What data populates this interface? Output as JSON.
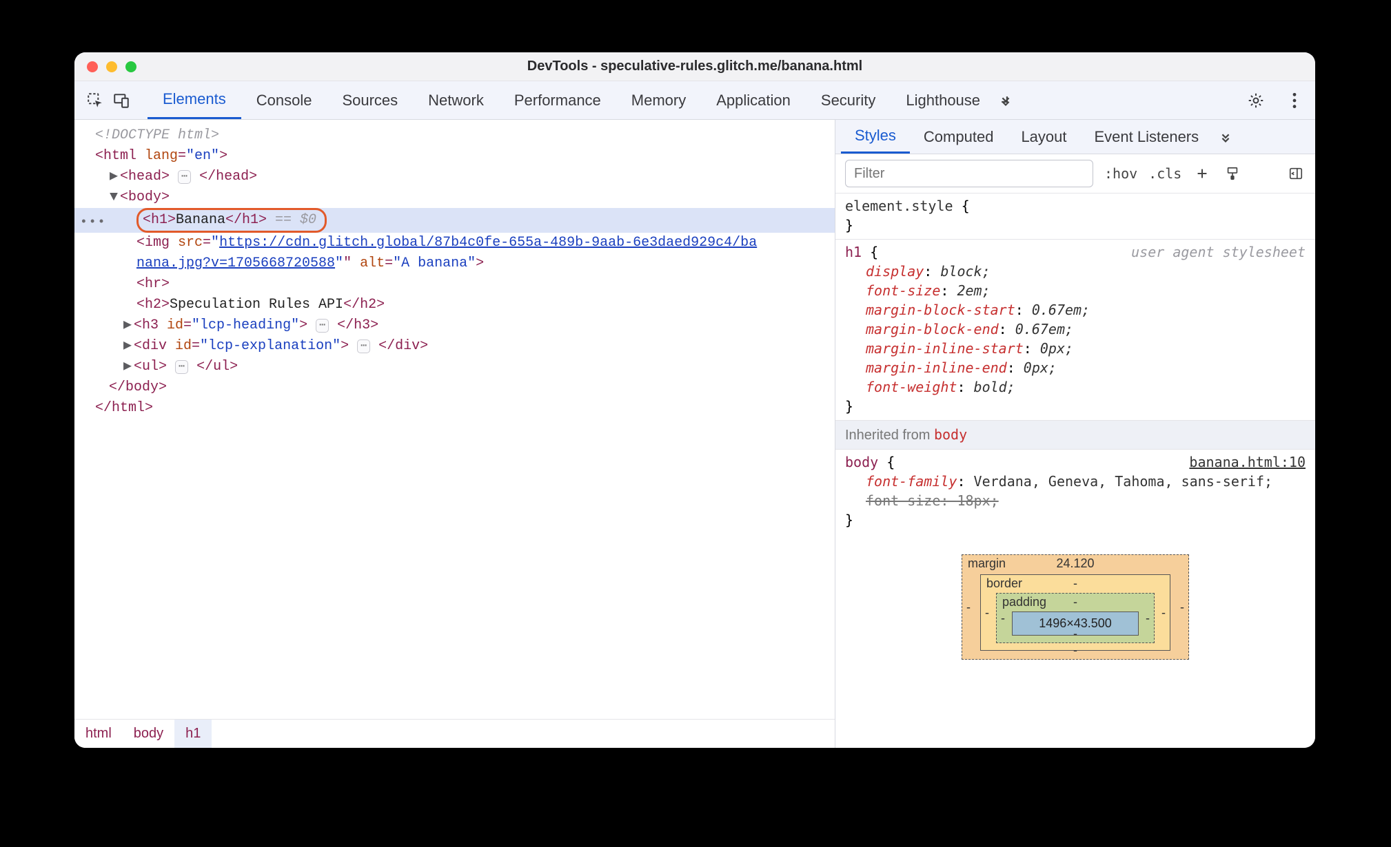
{
  "window": {
    "title": "DevTools - speculative-rules.glitch.me/banana.html"
  },
  "mainTabs": {
    "items": [
      "Elements",
      "Console",
      "Sources",
      "Network",
      "Performance",
      "Memory",
      "Application",
      "Security",
      "Lighthouse"
    ],
    "active": 0
  },
  "dom": {
    "doctype": "<!DOCTYPE html>",
    "htmlOpen": {
      "pre": "<html ",
      "attr": "lang",
      "eq": "=",
      "val": "\"en\"",
      "close": ">"
    },
    "headCollapse": {
      "open": "<head>",
      "close": "</head>"
    },
    "bodyOpen": "<body>",
    "selected": {
      "h1Open": "<h1>",
      "h1Text": "Banana",
      "h1Close": "</h1>",
      "refHint": " == $0"
    },
    "img": {
      "prefix": "<img ",
      "srcAttr": "src",
      "eq": "=",
      "q": "\"",
      "urlPart1": "https://cdn.glitch.global/87b4c0fe-655a-489b-9aab-6e3daed929c4/ba",
      "urlPart2": "nana.jpg?v=1705668720588",
      "midQuote": "\" ",
      "altAttr": "alt",
      "altVal": "\"A banana\"",
      "end": ">"
    },
    "hr": "<hr>",
    "h2": {
      "open": "<h2>",
      "text": "Speculation Rules API",
      "close": "</h2>"
    },
    "h3": {
      "open": "<h3 ",
      "idAttr": "id",
      "idVal": "\"lcp-heading\"",
      "mid": ">",
      "close": "</h3>"
    },
    "div": {
      "open": "<div ",
      "idAttr": "id",
      "idVal": "\"lcp-explanation\"",
      "mid": ">",
      "close": "</div>"
    },
    "ul": {
      "open": "<ul>",
      "close": "</ul>"
    },
    "bodyClose": "</body>",
    "htmlClose": "</html>"
  },
  "breadcrumb": [
    "html",
    "body",
    "h1"
  ],
  "rightTabs": {
    "items": [
      "Styles",
      "Computed",
      "Layout",
      "Event Listeners"
    ],
    "active": 0
  },
  "filter": {
    "placeholder": "Filter",
    "hov": ":hov",
    "cls": ".cls"
  },
  "styleRules": {
    "elementStyle": {
      "selector": "element.style",
      "open": " {",
      "close": "}"
    },
    "h1": {
      "selector": "h1",
      "open": " {",
      "close": "}",
      "sourceNote": "user agent stylesheet",
      "decls": [
        {
          "prop": "display",
          "colon": ": ",
          "val": "block;"
        },
        {
          "prop": "font-size",
          "colon": ": ",
          "val": "2em;"
        },
        {
          "prop": "margin-block-start",
          "colon": ": ",
          "val": "0.67em;"
        },
        {
          "prop": "margin-block-end",
          "colon": ": ",
          "val": "0.67em;"
        },
        {
          "prop": "margin-inline-start",
          "colon": ": ",
          "val": "0px;"
        },
        {
          "prop": "margin-inline-end",
          "colon": ": ",
          "val": "0px;"
        },
        {
          "prop": "font-weight",
          "colon": ": ",
          "val": "bold;"
        }
      ]
    },
    "inherited": {
      "label": "Inherited from ",
      "from": "body"
    },
    "body": {
      "selector": "body",
      "open": " {",
      "close": "}",
      "sourceLink": "banana.html:10",
      "decls": [
        {
          "prop": "font-family",
          "colon": ": ",
          "val": "Verdana, Geneva, Tahoma, sans-serif;",
          "struck": false
        },
        {
          "prop": "font-size",
          "colon": ": ",
          "val": "18px;",
          "struck": true
        }
      ]
    }
  },
  "boxModel": {
    "margin": {
      "label": "margin",
      "top": "24.120",
      "right": "-",
      "bottom": "-",
      "left": "-"
    },
    "border": {
      "label": "border",
      "top": "-",
      "right": "-",
      "bottom": "-",
      "left": "-"
    },
    "padding": {
      "label": "padding",
      "top": "-",
      "right": "-",
      "bottom": "-",
      "left": "-"
    },
    "content": "1496×43.500"
  }
}
